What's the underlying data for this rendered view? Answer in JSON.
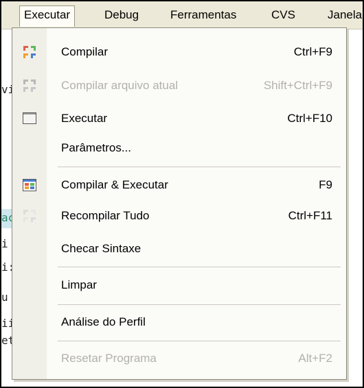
{
  "menubar": {
    "items": [
      {
        "label": "Executar"
      },
      {
        "label": "Debug"
      },
      {
        "label": "Ferramentas"
      },
      {
        "label": "CVS"
      },
      {
        "label": "Janela"
      }
    ]
  },
  "background": {
    "fragments": [
      "vi",
      "ac",
      "i",
      "i:",
      "u",
      "ii",
      "et"
    ]
  },
  "menu": {
    "items": [
      {
        "label": "Compilar",
        "shortcut": "Ctrl+F9",
        "enabled": true,
        "icon": "compile-icon"
      },
      {
        "label": "Compilar arquivo atual",
        "shortcut": "Shift+Ctrl+F9",
        "enabled": false,
        "icon": "compile-file-icon"
      },
      {
        "label": "Executar",
        "shortcut": "Ctrl+F10",
        "enabled": true,
        "icon": "run-window-icon"
      },
      {
        "label": "Parâmetros...",
        "shortcut": "",
        "enabled": true,
        "icon": ""
      },
      {
        "label": "Compilar & Executar",
        "shortcut": "F9",
        "enabled": true,
        "icon": "compile-run-icon"
      },
      {
        "label": "Recompilar Tudo",
        "shortcut": "Ctrl+F11",
        "enabled": true,
        "icon": "rebuild-all-icon"
      },
      {
        "label": "Checar Sintaxe",
        "shortcut": "",
        "enabled": true,
        "icon": ""
      },
      {
        "label": "Limpar",
        "shortcut": "",
        "enabled": true,
        "icon": ""
      },
      {
        "label": "Análise do Perfil",
        "shortcut": "",
        "enabled": true,
        "icon": ""
      },
      {
        "label": "Resetar Programa",
        "shortcut": "Alt+F2",
        "enabled": false,
        "icon": ""
      }
    ]
  }
}
